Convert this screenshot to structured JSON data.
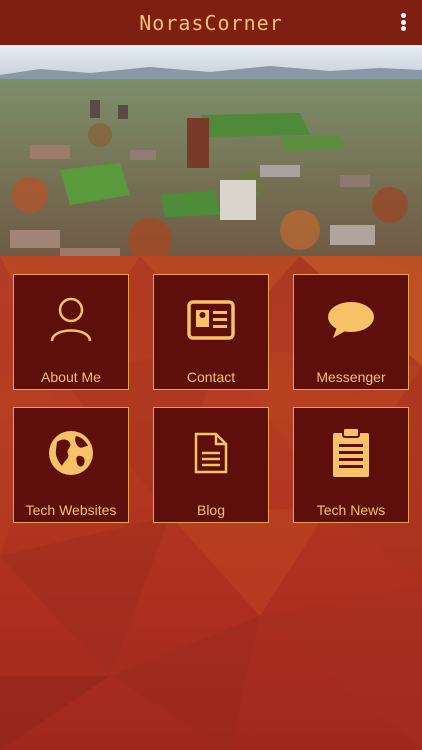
{
  "app_bar": {
    "title": "NorasCorner",
    "menu_icon": "more-vert-icon"
  },
  "hero": {
    "alt": "campus-aerial-photo"
  },
  "colors": {
    "app_bar": "#7f1f14",
    "accent": "#f7c165",
    "tile_bg": "#5e0f0b",
    "tile_border": "#e8a24b"
  },
  "tiles": [
    {
      "label": "About Me",
      "icon": "person-icon"
    },
    {
      "label": "Contact",
      "icon": "id-card-icon"
    },
    {
      "label": "Messenger",
      "icon": "chat-bubble-icon"
    },
    {
      "label": "Tech Websites",
      "icon": "globe-icon"
    },
    {
      "label": "Blog",
      "icon": "document-icon"
    },
    {
      "label": "Tech News",
      "icon": "clipboard-icon"
    }
  ]
}
